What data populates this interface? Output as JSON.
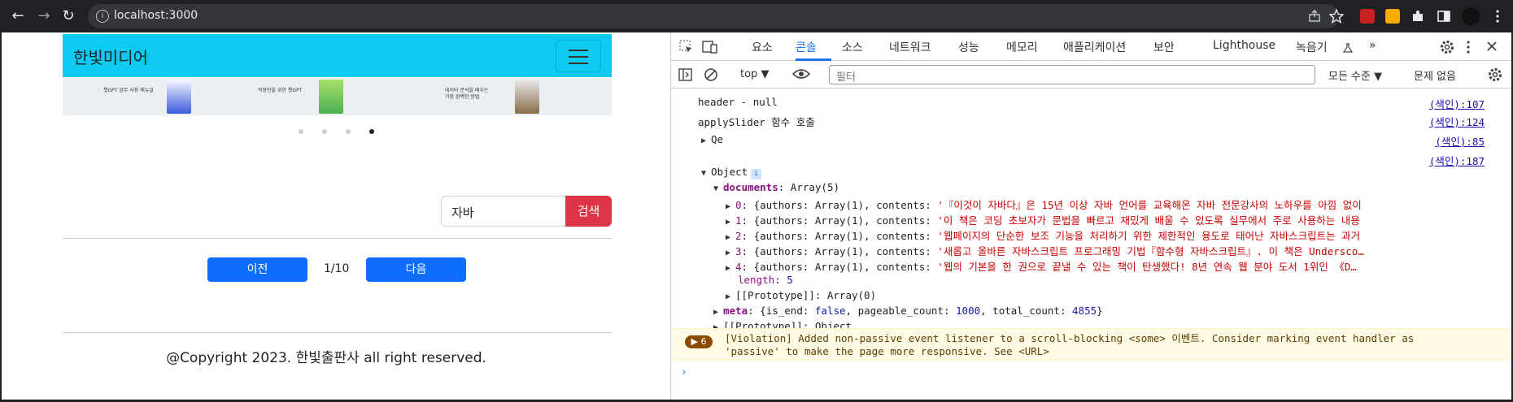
{
  "browser": {
    "url": "localhost:3000",
    "back_icon": "arrow-left",
    "forward_icon": "arrow-right",
    "reload_icon": "reload",
    "info_icon": "info-circle"
  },
  "site": {
    "brand": "한빛미디어",
    "navbar_color": "#0dcaf0",
    "search_value": "자바",
    "search_button": "검색",
    "prev_button": "이전",
    "page_indicator": "1/10",
    "next_button": "다음",
    "footer": "@Copyright 2023. 한빛출판사 all right reserved.",
    "slides": [
      {
        "line1": "챗GPT 업무 사용 매뉴얼",
        "line2": ""
      },
      {
        "line1": "직장인을 위한 챗GPT",
        "line2": ""
      },
      {
        "line1": "데이터 분석을 배우는",
        "line2": "가장 완벽한 방법"
      }
    ],
    "active_dot": 4
  },
  "devtools": {
    "tabs": [
      "요소",
      "콘솔",
      "소스",
      "네트워크",
      "성능",
      "메모리",
      "애플리케이션",
      "보안",
      "Lighthouse",
      "녹음기"
    ],
    "active_tab": "콘솔",
    "more_tabs": "»",
    "context": "top",
    "filter_placeholder": "필터",
    "levels": "모든 수준",
    "issues": "문제 없음"
  },
  "console": {
    "line1": "header - null",
    "line1_src": "(색인):107",
    "line2": "applySlider 함수 호출",
    "line2_src": "(색인):124",
    "line3": "Qe",
    "line3_src": "(색인):85",
    "line4_src": "(색인):187",
    "object_label": "Object",
    "documents_key": "documents",
    "documents_type": "Array(5)",
    "docs": [
      {
        "idx": "0",
        "prefix": "{authors: Array(1), contents: ",
        "text": "'『이것이 자바다』은 15년 이상 자바 언어를 교육해온 자바 전문강사의 노하우를 아낌 없이"
      },
      {
        "idx": "1",
        "prefix": "{authors: Array(1), contents: ",
        "text": "'이 책은 코딩 초보자가 문법을 빠르고 재밌게 배울 수 있도록 실무에서 주로 사용하는 내용"
      },
      {
        "idx": "2",
        "prefix": "{authors: Array(1), contents: ",
        "text": "'웹페이지의 단순한 보조 기능을 처리하기 위한 제한적인 용도로 태어난 자바스크립트는 과거"
      },
      {
        "idx": "3",
        "prefix": "{authors: Array(1), contents: ",
        "text": "'새롭고 올바른 자바스크립트 프로그래밍 기법『함수형 자바스크립트』. 이 책은 Undersco…"
      },
      {
        "idx": "4",
        "prefix": "{authors: Array(1), contents: ",
        "text": "'웹의 기본을 한 권으로 끝낼 수 있는 책이 탄생했다! 8년 연속 웹 분야 도서 1위인 《D…"
      }
    ],
    "length_key": "length",
    "length_value": "5",
    "proto_array": "[[Prototype]]: Array(0)",
    "meta_key": "meta",
    "meta_prefix": "{is_end: ",
    "meta_is_end": "false",
    "meta_mid": ", pageable_count: ",
    "meta_pageable": "1000",
    "meta_mid2": ", total_count: ",
    "meta_total": "4855",
    "meta_suffix": "}",
    "proto_object": "[[Prototype]]: Object",
    "violation_count": "6",
    "violation_text": "[Violation] Added non-passive event listener to a scroll-blocking <some> 이벤트. Consider marking event handler as\n'passive' to make the page more responsive. See <URL>"
  }
}
